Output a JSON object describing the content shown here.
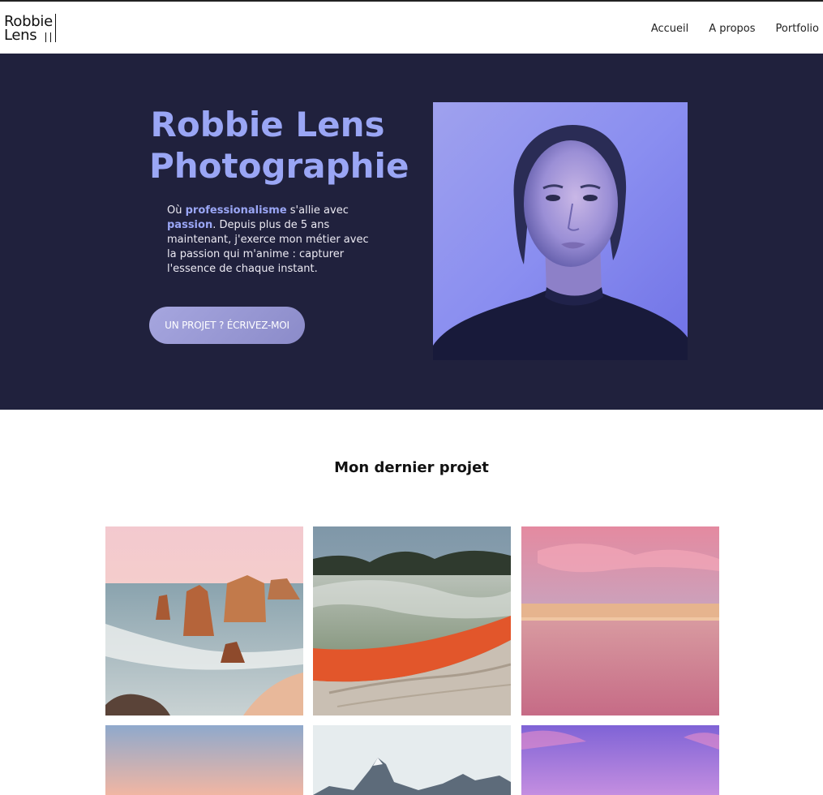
{
  "header": {
    "logo_line1": "Robbie",
    "logo_line2": "Lens",
    "nav": [
      {
        "label": "Accueil"
      },
      {
        "label": "A propos"
      },
      {
        "label": "Portfolio"
      }
    ]
  },
  "hero": {
    "title_line1": "Robbie Lens",
    "title_line2": "Photographie",
    "desc_prefix": "Où ",
    "desc_hl1": "professionalisme",
    "desc_mid": " s'allie avec ",
    "desc_hl2": "passion",
    "desc_suffix": ". Depuis plus de 5 ans maintenant, j'exerce mon métier avec la passion qui m'anime : capturer l'essence de chaque instant.",
    "cta_label": "UN PROJET ? ÉCRIVEZ-MOI",
    "accent": "#9aa6f5",
    "background": "#20213d"
  },
  "project": {
    "title": "Mon dernier projet"
  }
}
